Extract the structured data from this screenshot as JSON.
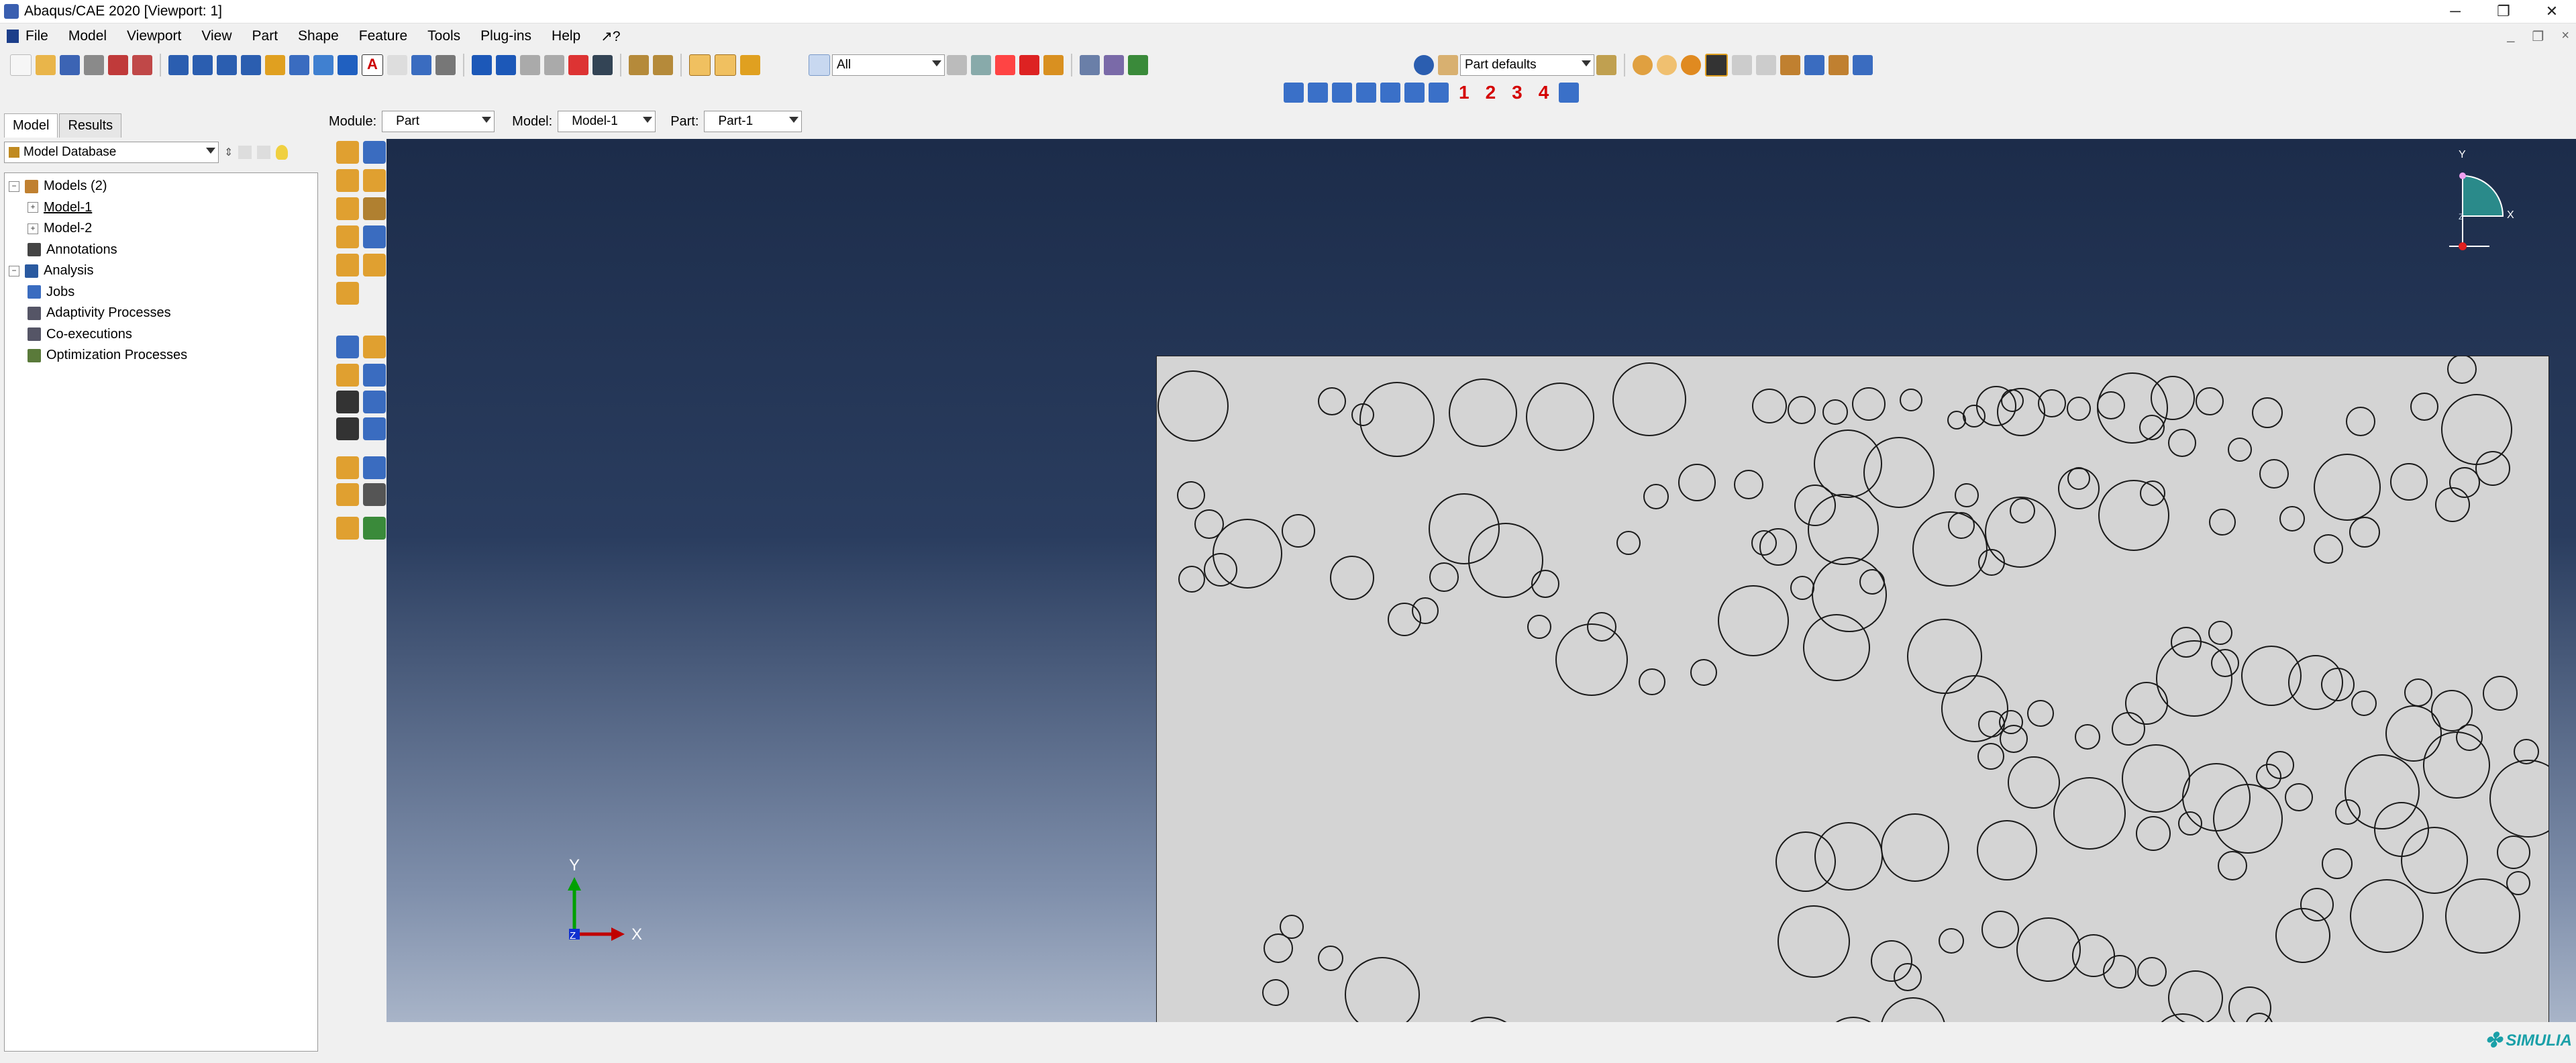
{
  "window": {
    "title": "Abaqus/CAE 2020 [Viewport: 1]",
    "controls": [
      "─",
      "❐",
      "✕"
    ]
  },
  "menubar": {
    "items": [
      "File",
      "Model",
      "Viewport",
      "View",
      "Part",
      "Shape",
      "Feature",
      "Tools",
      "Plug-ins",
      "Help",
      "↗?"
    ],
    "mdi_controls": [
      "_",
      "❐",
      "×"
    ]
  },
  "selection": {
    "filter_value": "All"
  },
  "render_style": {
    "value": "Part defaults"
  },
  "view_numbers": [
    "1",
    "2",
    "3",
    "4"
  ],
  "context": {
    "module_label": "Module:",
    "module_value": "Part",
    "model_label": "Model:",
    "model_value": "Model-1",
    "part_label": "Part:",
    "part_value": "Part-1"
  },
  "left_panel": {
    "tabs": [
      "Model",
      "Results"
    ],
    "database": "Model Database",
    "tree": [
      {
        "label": "Models (2)",
        "exp": "−",
        "indent": 0,
        "icon": "models-icon"
      },
      {
        "label": "Model-1",
        "exp": "+",
        "indent": 1,
        "icon": "",
        "underline": true
      },
      {
        "label": "Model-2",
        "exp": "+",
        "indent": 1,
        "icon": ""
      },
      {
        "label": "Annotations",
        "exp": "",
        "indent": 1,
        "icon": "annotations-icon"
      },
      {
        "label": "Analysis",
        "exp": "−",
        "indent": 0,
        "icon": "analysis-icon"
      },
      {
        "label": "Jobs",
        "exp": "",
        "indent": 1,
        "icon": "jobs-icon"
      },
      {
        "label": "Adaptivity Processes",
        "exp": "",
        "indent": 1,
        "icon": "adaptivity-icon"
      },
      {
        "label": "Co-executions",
        "exp": "",
        "indent": 1,
        "icon": "coexec-icon"
      },
      {
        "label": "Optimization Processes",
        "exp": "",
        "indent": 1,
        "icon": "optimization-icon"
      }
    ]
  },
  "viewport": {
    "triad": {
      "x_label": "X",
      "y_label": "Y",
      "z_label": "Z"
    },
    "compass": {
      "x_label": "X",
      "y_label": "Y",
      "z_label": "Z"
    }
  },
  "brand": "SIMULIA",
  "colors": {
    "viewport_top": "#1c2c4a",
    "viewport_bottom": "#a8b4c8",
    "part_fill": "#d4d4d4",
    "triad_x": "#c00000",
    "triad_y": "#00a000",
    "triad_z": "#1030d0",
    "compass_fill": "#2a8a8a"
  }
}
